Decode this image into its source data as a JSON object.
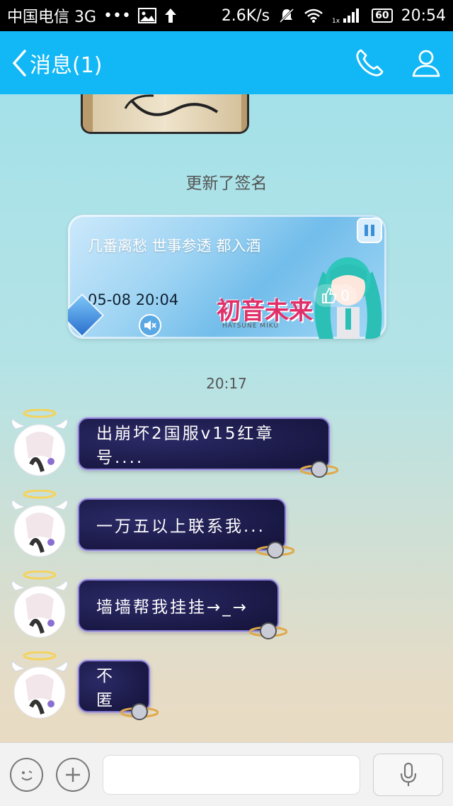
{
  "statusbar": {
    "carrier": "中国电信 3G",
    "dots": "•••",
    "speed": "2.6K/s",
    "battery": "60",
    "time": "20:54"
  },
  "navbar": {
    "back_label": "消息(1)",
    "icons": [
      "phone-icon",
      "profile-icon"
    ]
  },
  "chat": {
    "sys_label": "更新了签名",
    "signature": {
      "text": "几番离愁 世事参透 都入酒",
      "date": "05-08 20:04",
      "brand": "初音未来",
      "brand_sub": "HATSUNE MIKU",
      "likes": "0"
    },
    "time_label": "20:17",
    "messages": [
      {
        "text": "出崩坏2国服v15红章号...."
      },
      {
        "text": "一万五以上联系我..."
      },
      {
        "text": "墙墙帮我挂挂→_→"
      },
      {
        "text": "不匿"
      }
    ]
  },
  "colors": {
    "nav": "#12b7f5",
    "bubble": "#1c1b4a",
    "bubble_border": "#8a7fd6"
  }
}
